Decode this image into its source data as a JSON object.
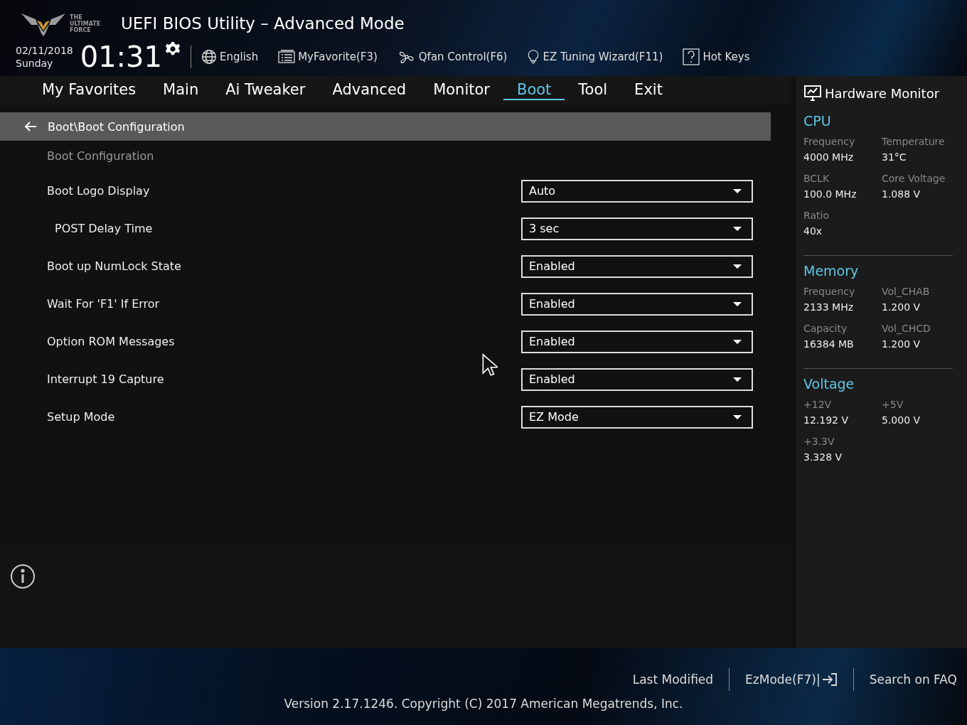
{
  "header": {
    "logo_text": [
      "THE",
      "ULTIMATE",
      "FORCE"
    ],
    "title": "UEFI BIOS Utility – Advanced Mode",
    "date": "02/11/2018",
    "day": "Sunday",
    "time": "01:31",
    "tools": [
      {
        "kind": "globe",
        "label": "English"
      },
      {
        "kind": "list",
        "label": "MyFavorite(F3)"
      },
      {
        "kind": "fan",
        "label": "Qfan Control(F6)"
      },
      {
        "kind": "bulb",
        "label": "EZ Tuning Wizard(F11)"
      },
      {
        "kind": "help",
        "label": "Hot Keys"
      }
    ]
  },
  "tabs": [
    {
      "label": "My Favorites",
      "selected": false
    },
    {
      "label": "Main",
      "selected": false
    },
    {
      "label": "Ai Tweaker",
      "selected": false
    },
    {
      "label": "Advanced",
      "selected": false
    },
    {
      "label": "Monitor",
      "selected": false
    },
    {
      "label": "Boot",
      "selected": true
    },
    {
      "label": "Tool",
      "selected": false
    },
    {
      "label": "Exit",
      "selected": false
    }
  ],
  "breadcrumb": "Boot\\Boot Configuration",
  "section": "Boot Configuration",
  "settings": [
    {
      "label": "Boot Logo Display",
      "value": "Auto",
      "children": [
        {
          "label": "POST Delay Time",
          "value": "3 sec"
        }
      ]
    },
    {
      "label": "Boot up NumLock State",
      "value": "Enabled"
    },
    {
      "label": "Wait For 'F1' If Error",
      "value": "Enabled"
    },
    {
      "label": "Option ROM Messages",
      "value": "Enabled"
    },
    {
      "label": "Interrupt 19 Capture",
      "value": "Enabled"
    },
    {
      "label": "Setup Mode",
      "value": "EZ Mode"
    }
  ],
  "hardware_monitor": {
    "title": "Hardware Monitor",
    "groups": [
      {
        "title": "CPU",
        "items": [
          {
            "label": "Frequency",
            "value": "4000 MHz"
          },
          {
            "label": "Temperature",
            "value": "31°C"
          },
          {
            "label": "BCLK",
            "value": "100.0 MHz"
          },
          {
            "label": "Core Voltage",
            "value": "1.088 V"
          },
          {
            "label": "Ratio",
            "value": "40x"
          }
        ]
      },
      {
        "title": "Memory",
        "items": [
          {
            "label": "Frequency",
            "value": "2133 MHz"
          },
          {
            "label": "Vol_CHAB",
            "value": "1.200 V"
          },
          {
            "label": "Capacity",
            "value": "16384 MB"
          },
          {
            "label": "Vol_CHCD",
            "value": "1.200 V"
          }
        ]
      },
      {
        "title": "Voltage",
        "items": [
          {
            "label": "+12V",
            "value": "12.192 V"
          },
          {
            "label": "+5V",
            "value": "5.000 V"
          },
          {
            "label": "+3.3V",
            "value": "3.328 V"
          }
        ]
      }
    ]
  },
  "footer": {
    "links": [
      {
        "label": "Last Modified",
        "kind": "text"
      },
      {
        "label": "EzMode(F7)|",
        "kind": "exit"
      },
      {
        "label": "Search on FAQ",
        "kind": "text"
      }
    ],
    "version": "Version 2.17.1246. Copyright (C) 2017 American Megatrends, Inc."
  }
}
